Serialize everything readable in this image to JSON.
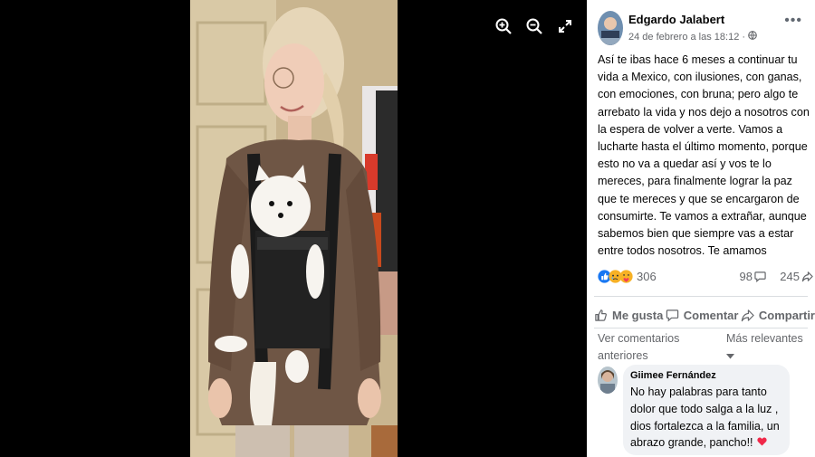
{
  "viewer": {
    "tools": [
      {
        "icon": "zoom-in-icon"
      },
      {
        "icon": "zoom-out-icon"
      },
      {
        "icon": "fullscreen-icon"
      }
    ]
  },
  "post": {
    "author": "Edgardo Jalabert",
    "date": "24 de febrero a las 18:12 ·",
    "privacy_icon": "globe-icon",
    "more_label": "•••",
    "text": "Así te ibas hace 6 meses a continuar tu vida a Mexico, con ilusiones, con ganas, con emociones, con bruna; pero algo te arrebato la vida y nos dejo a nosotros con la espera de volver a verte. Vamos a lucharte hasta el último momento, porque esto no va a quedar así y vos te lo mereces, para finalmente lograr la paz que te mereces y que se encargaron de consumirte. Te vamos a extrañar, aunque sabemos bien que siempre vas a estar entre todos nosotros. Te amamos"
  },
  "stats": {
    "reactions_count": "306",
    "reaction_icons": [
      "like-icon",
      "sad-icon",
      "care-icon"
    ],
    "comments_count": "98",
    "shares_count": "245"
  },
  "actions": {
    "like": "Me gusta",
    "comment": "Comentar",
    "share": "Compartir"
  },
  "comments": {
    "view_more": "Ver comentarios anteriores",
    "sort": "Más relevantes",
    "items": [
      {
        "author": "Giimee Fernández",
        "text": "No hay palabras para tanto dolor que todo salga a la luz , dios fortalezca a la familia, un abrazo grande, pancho!!"
      }
    ]
  },
  "colors": {
    "like_blue": "#1877f2",
    "sad_yellow": "#f7b125",
    "care_heart": "#f33e58",
    "secondary_text": "#65676b",
    "bubble_bg": "#f0f2f5"
  }
}
